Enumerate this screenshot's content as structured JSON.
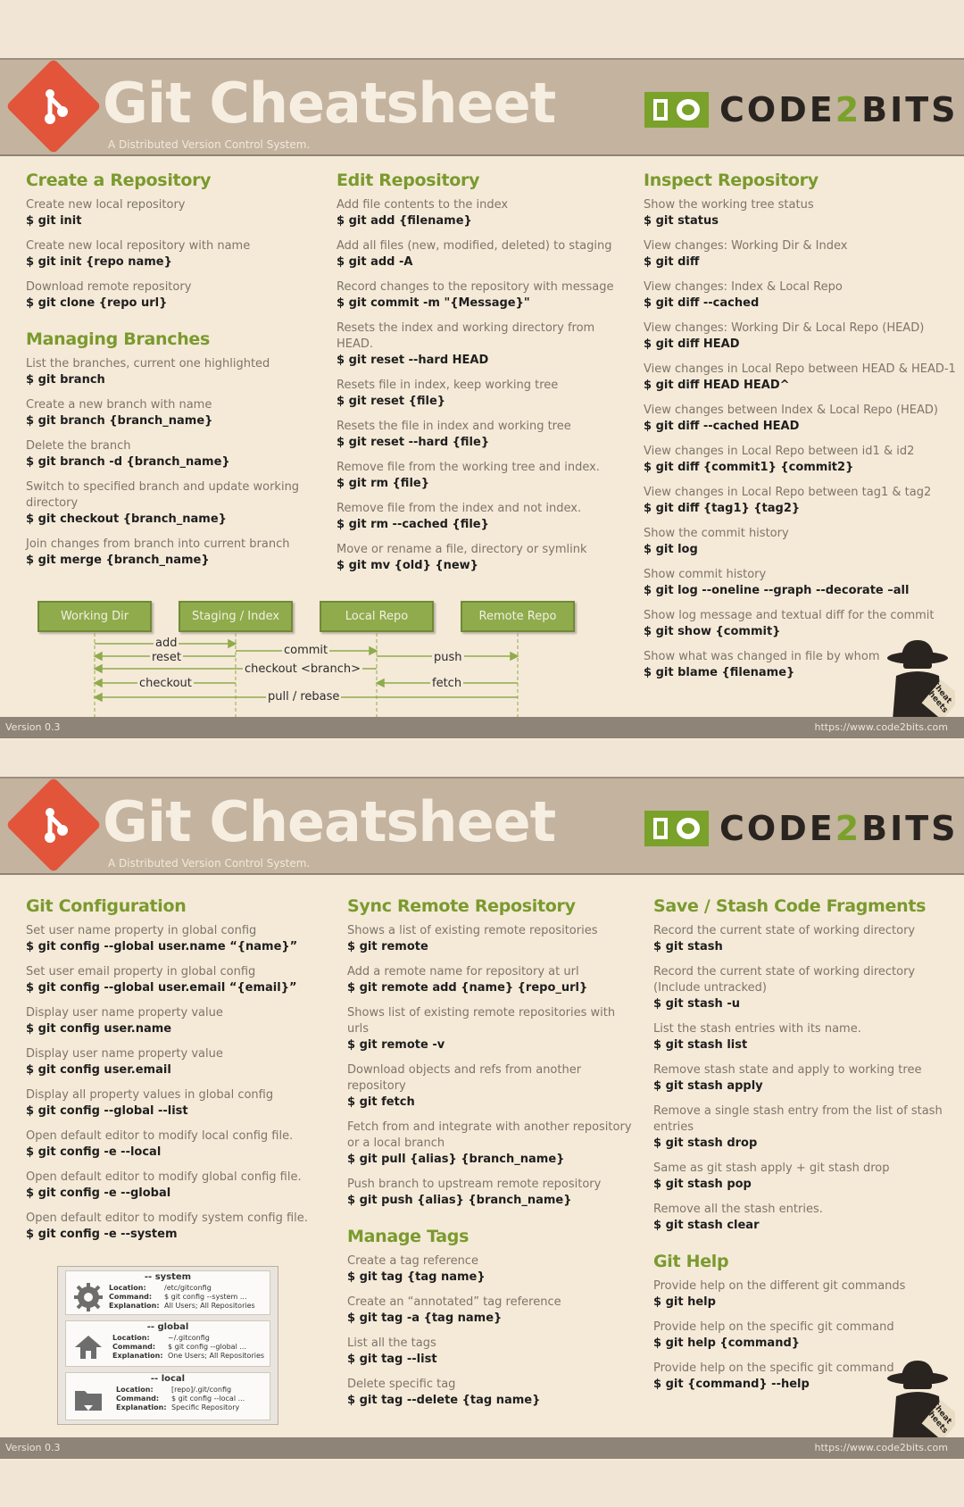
{
  "sheet": {
    "title": "Git Cheatsheet",
    "subtitle": "A Distributed Version Control System.",
    "brand_prefix": "CODE",
    "brand_two": "2",
    "brand_suffix": "BITS",
    "version": "Version 0.3",
    "url": "https://www.code2bits.com",
    "spy_label": "Cheat Sheets",
    "accent_color": "#7a9a2e",
    "logo_color": "#e2553a"
  },
  "card1": {
    "col1": {
      "s1": {
        "title": "Create a Repository",
        "items": [
          {
            "desc": "Create new local repository",
            "cmd": "$ git init"
          },
          {
            "desc": "Create new local repository with name",
            "cmd": "$ git init {repo name}"
          },
          {
            "desc": "Download remote repository",
            "cmd": "$  git clone {repo url}"
          }
        ]
      },
      "s2": {
        "title": "Managing Branches",
        "items": [
          {
            "desc": "List the branches, current one highlighted",
            "cmd": "$ git branch"
          },
          {
            "desc": "Create a new branch with name",
            "cmd": "$ git branch {branch_name}"
          },
          {
            "desc": "Delete the branch",
            "cmd": "$ git branch -d {branch_name}"
          },
          {
            "desc": "Switch to specified branch and update working directory",
            "cmd": "$ git checkout {branch_name}"
          },
          {
            "desc": "Join changes from branch into current branch",
            "cmd": "$ git merge {branch_name}"
          }
        ]
      }
    },
    "col2": {
      "title": "Edit Repository",
      "items": [
        {
          "desc": "Add file contents to the index",
          "cmd": "$ git add {filename}"
        },
        {
          "desc": "Add all files (new, modified, deleted) to staging",
          "cmd": "$ git add -A"
        },
        {
          "desc": "Record changes to the repository with message",
          "cmd": "$ git commit -m \"{Message}\""
        },
        {
          "desc": "Resets the index and working directory from HEAD.",
          "cmd": "$ git reset --hard HEAD"
        },
        {
          "desc": "Resets file in index, keep working tree",
          "cmd": "$ git reset {file}"
        },
        {
          "desc": "Resets the file in index and working tree",
          "cmd": "$ git reset --hard {file}"
        },
        {
          "desc": "Remove file from the working tree and index.",
          "cmd": "$ git rm {file}"
        },
        {
          "desc": "Remove file from the index and not index.",
          "cmd": "$ git rm --cached {file}"
        },
        {
          "desc": "Move or rename a file, directory or symlink",
          "cmd": "$ git mv {old} {new}"
        }
      ]
    },
    "col3": {
      "title": "Inspect Repository",
      "items": [
        {
          "desc": "Show the working tree status",
          "cmd": "$ git status"
        },
        {
          "desc": "View changes: Working Dir & Index",
          "cmd": "$ git diff"
        },
        {
          "desc": "View changes: Index & Local Repo",
          "cmd": "$ git diff --cached"
        },
        {
          "desc": "View changes: Working Dir & Local Repo (HEAD)",
          "cmd": "$ git diff HEAD"
        },
        {
          "desc": "View changes in Local Repo between HEAD & HEAD-1",
          "cmd": "$ git diff HEAD HEAD^"
        },
        {
          "desc": "View changes between Index & Local Repo (HEAD)",
          "cmd": "$ git diff --cached HEAD"
        },
        {
          "desc": "View changes in Local Repo between id1 & id2",
          "cmd": "$ git diff {commit1} {commit2}"
        },
        {
          "desc": "View changes in Local Repo between tag1 & tag2",
          "cmd": "$ git diff {tag1} {tag2}"
        },
        {
          "desc": "Show the commit history",
          "cmd": "$ git log"
        },
        {
          "desc": "Show commit history",
          "cmd": "$ git log --oneline --graph --decorate –all"
        },
        {
          "desc": "Show log message and textual diff for the commit",
          "cmd": "$ git show {commit}"
        },
        {
          "desc": "Show what was changed in file by whom",
          "cmd": "$ git blame {filename}"
        }
      ]
    },
    "diagram": {
      "stages": [
        "Working Dir",
        "Staging / Index",
        "Local Repo",
        "Remote Repo"
      ],
      "arrows": [
        "add",
        "reset",
        "commit",
        "checkout <branch>",
        "push",
        "checkout",
        "fetch",
        "pull / rebase"
      ]
    }
  },
  "card2": {
    "col1": {
      "title": "Git Configuration",
      "items": [
        {
          "desc": "Set user name property in global config",
          "cmd": "$ git config --global user.name “{name}”"
        },
        {
          "desc": "Set user email property in global config",
          "cmd": "$ git config --global user.email “{email}”"
        },
        {
          "desc": "Display user name property value",
          "cmd": "$ git config user.name"
        },
        {
          "desc": "Display user name property value",
          "cmd": "$ git config user.email"
        },
        {
          "desc": "Display all property values in global config",
          "cmd": "$ git config --global --list"
        },
        {
          "desc": "Open default editor to modify local config file.",
          "cmd": "$ git config -e --local"
        },
        {
          "desc": "Open default editor to modify global config file.",
          "cmd": "$ git config -e --global"
        },
        {
          "desc": "Open default editor to modify system config file.",
          "cmd": "$ git config -e --system"
        }
      ],
      "config_levels": [
        {
          "name": "-- system",
          "location": "/etc/gitconfig",
          "command": "$ git config --system ...",
          "explanation": "All Users; All Repositories",
          "icon": "gear-icon"
        },
        {
          "name": "-- global",
          "location": "~/.gitconfig",
          "command": "$ git config --global ...",
          "explanation": "One Users; All Repositories",
          "icon": "home-icon"
        },
        {
          "name": "-- local",
          "location": "[repo]/.git/config",
          "command": "$ git config --local ...",
          "explanation": "Specific Repository",
          "icon": "folder-icon"
        }
      ],
      "config_labels": {
        "location": "Location:",
        "command": "Command:",
        "explanation": "Explanation:"
      }
    },
    "col2": {
      "s1": {
        "title": "Sync Remote Repository",
        "items": [
          {
            "desc": "Shows a list of existing remote repositories",
            "cmd": "$ git remote"
          },
          {
            "desc": "Add a remote name for repository at url",
            "cmd": "$ git remote add {name} {repo_url}"
          },
          {
            "desc": "Shows list of existing remote repositories with urls",
            "cmd": "$ git remote -v"
          },
          {
            "desc": "Download objects and refs from another repository",
            "cmd": "$ git fetch"
          },
          {
            "desc": "Fetch from and integrate with another repository or a local branch",
            "cmd": "$ git pull {alias} {branch_name}"
          },
          {
            "desc": "Push branch to upstream remote repository",
            "cmd": "$ git push {alias} {branch_name}"
          }
        ]
      },
      "s2": {
        "title": "Manage Tags",
        "items": [
          {
            "desc": "Create a tag reference",
            "cmd": "$ git tag {tag name}"
          },
          {
            "desc": "Create an “annotated” tag reference",
            "cmd": "$ git tag -a {tag name}"
          },
          {
            "desc": "List all the tags",
            "cmd": "$ git tag --list"
          },
          {
            "desc": "Delete specific tag",
            "cmd": "$ git tag --delete {tag name}"
          }
        ]
      }
    },
    "col3": {
      "s1": {
        "title": "Save / Stash Code Fragments",
        "items": [
          {
            "desc": "Record the current state of working directory",
            "cmd": "$ git stash"
          },
          {
            "desc": "Record the current state of working directory (Include untracked)",
            "cmd": "$ git stash -u"
          },
          {
            "desc": "List the stash entries with its name.",
            "cmd": "$ git stash list"
          },
          {
            "desc": "Remove stash state and apply to working tree",
            "cmd": "$ git stash apply"
          },
          {
            "desc": "Remove a single stash entry from the list of stash entries",
            "cmd": "$ git stash drop"
          },
          {
            "desc": "Same as git stash apply + git stash drop",
            "cmd": "$ git stash pop"
          },
          {
            "desc": "Remove all the stash entries.",
            "cmd": "$ git stash clear"
          }
        ]
      },
      "s2": {
        "title": "Git Help",
        "items": [
          {
            "desc": "Provide help on the different git commands",
            "cmd": "$ git help"
          },
          {
            "desc": "Provide help on the specific git command",
            "cmd": "$ git help {command}"
          },
          {
            "desc": "Provide help on the specific git command",
            "cmd": "$ git {command} --help"
          }
        ]
      }
    }
  }
}
